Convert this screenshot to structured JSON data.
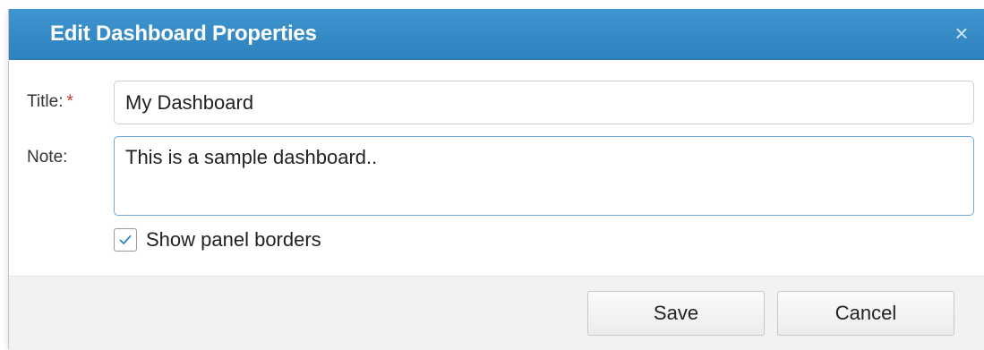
{
  "dialog": {
    "title": "Edit Dashboard Properties",
    "close_glyph": "×"
  },
  "form": {
    "title_label": "Title:",
    "title_required_mark": "*",
    "title_value": "My Dashboard",
    "note_label": "Note:",
    "note_value": "This is a sample dashboard..",
    "show_borders_label": "Show panel borders",
    "show_borders_checked": true
  },
  "buttons": {
    "save_label": "Save",
    "cancel_label": "Cancel"
  },
  "colors": {
    "titlebar": "#3a8fcb",
    "focus_border": "#6fa8d8",
    "required": "#c0392b",
    "footer_bg": "#f2f2f2"
  },
  "icons": {
    "close": "close-icon",
    "check": "checkmark-icon"
  }
}
